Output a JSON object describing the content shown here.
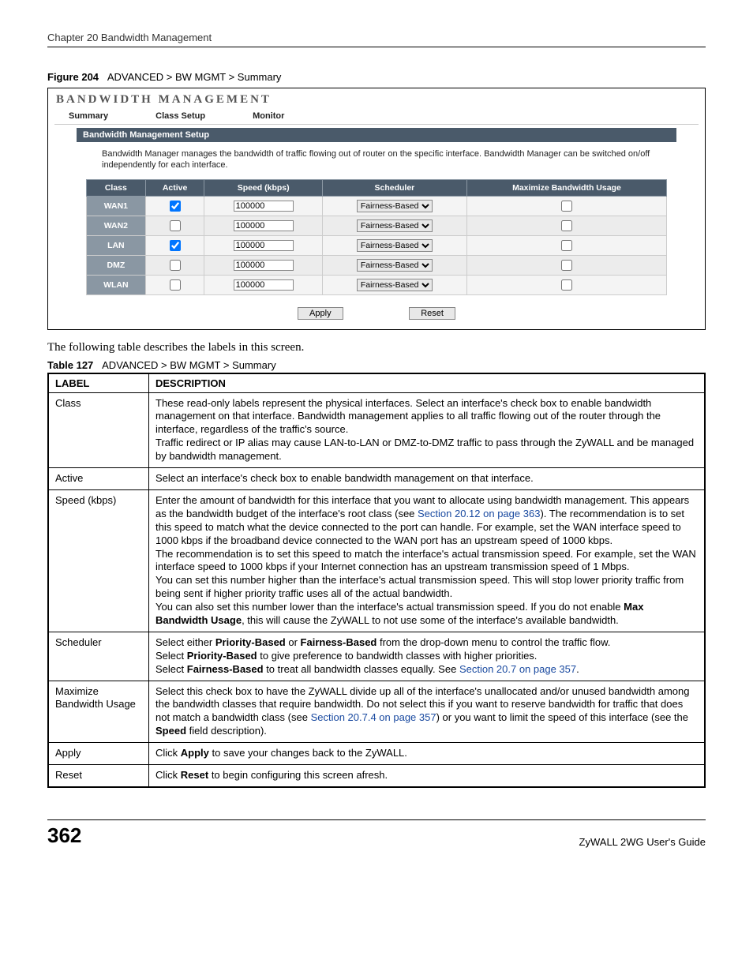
{
  "chapter": "Chapter 20 Bandwidth Management",
  "figure": {
    "label": "Figure 204",
    "caption": "ADVANCED > BW MGMT > Summary"
  },
  "screenshot": {
    "title": "BANDWIDTH MANAGEMENT",
    "tabs": {
      "summary": "Summary",
      "class_setup": "Class Setup",
      "monitor": "Monitor"
    },
    "section_bar": "Bandwidth Management Setup",
    "description": "Bandwidth Manager manages the bandwidth of traffic flowing out of router on the specific interface. Bandwidth Manager can be switched on/off independently for each interface.",
    "headers": {
      "class": "Class",
      "active": "Active",
      "speed": "Speed (kbps)",
      "scheduler": "Scheduler",
      "max": "Maximize Bandwidth Usage"
    },
    "rows": [
      {
        "class": "WAN1",
        "active": true,
        "speed": "100000",
        "scheduler": "Fairness-Based",
        "max": false
      },
      {
        "class": "WAN2",
        "active": false,
        "speed": "100000",
        "scheduler": "Fairness-Based",
        "max": false
      },
      {
        "class": "LAN",
        "active": true,
        "speed": "100000",
        "scheduler": "Fairness-Based",
        "max": false
      },
      {
        "class": "DMZ",
        "active": false,
        "speed": "100000",
        "scheduler": "Fairness-Based",
        "max": false
      },
      {
        "class": "WLAN",
        "active": false,
        "speed": "100000",
        "scheduler": "Fairness-Based",
        "max": false
      }
    ],
    "buttons": {
      "apply": "Apply",
      "reset": "Reset"
    }
  },
  "lead_text": "The following table describes the labels in this screen.",
  "table_caption": {
    "label": "Table 127",
    "caption": "ADVANCED > BW MGMT > Summary"
  },
  "desc_headers": {
    "label": "LABEL",
    "description": "DESCRIPTION"
  },
  "desc_rows": {
    "class": {
      "label": "Class",
      "p1": "These read-only labels represent the physical interfaces. Select an interface's check box to enable bandwidth management on that interface. Bandwidth management applies to all traffic flowing out of the router through the interface, regardless of the traffic's source.",
      "p2": "Traffic redirect or IP alias may cause LAN-to-LAN or DMZ-to-DMZ traffic to pass through the ZyWALL and be managed by bandwidth management."
    },
    "active": {
      "label": "Active",
      "p1": "Select an interface's check box to enable bandwidth management on that interface."
    },
    "speed": {
      "label": "Speed (kbps)",
      "p1a": "Enter the amount of bandwidth for this interface that you want to allocate using bandwidth management. This appears as the bandwidth budget of the interface's root class (see ",
      "link1": "Section 20.12 on page 363",
      "p1b": "). The recommendation is to set this speed to match what the device connected to the port can handle. For example, set the WAN interface speed to 1000 kbps if the broadband device connected to the WAN port has an upstream speed of 1000 kbps.",
      "p2": "The recommendation is to set this speed to match the interface's actual transmission speed. For example, set the WAN interface speed to 1000 kbps if your Internet connection has an upstream transmission speed of 1 Mbps.",
      "p3": "You can set this number higher than the interface's actual transmission speed. This will stop lower priority traffic from being sent if higher priority traffic uses all of the actual bandwidth.",
      "p4a": "You can also set this number lower than the interface's actual transmission speed. If you do not enable ",
      "p4b_bold": "Max Bandwidth Usage",
      "p4c": ", this will cause the ZyWALL to not use some of the interface's available bandwidth."
    },
    "scheduler": {
      "label": "Scheduler",
      "p1a": "Select either ",
      "p1b_bold": "Priority-Based",
      "p1c": " or ",
      "p1d_bold": "Fairness-Based",
      "p1e": " from the drop-down menu to control the traffic flow.",
      "p2a": "Select ",
      "p2b_bold": "Priority-Based",
      "p2c": " to give preference to bandwidth classes with higher priorities.",
      "p3a": "Select ",
      "p3b_bold": "Fairness-Based",
      "p3c": " to treat all bandwidth classes equally. See ",
      "link1": "Section 20.7 on page 357",
      "p3d": "."
    },
    "max": {
      "label": "Maximize Bandwidth Usage",
      "p1a": "Select this check box to have the ZyWALL divide up all of the interface's unallocated and/or unused bandwidth among the bandwidth classes that require bandwidth. Do not select this if you want to reserve bandwidth for traffic that does not match a bandwidth class (see ",
      "link1": "Section 20.7.4 on page 357",
      "p1b": ") or you want to limit the speed of this interface (see the ",
      "p1c_bold": "Speed",
      "p1d": " field description)."
    },
    "apply": {
      "label": "Apply",
      "p1a": "Click ",
      "p1b_bold": "Apply",
      "p1c": " to save your changes back to the ZyWALL."
    },
    "reset": {
      "label": "Reset",
      "p1a": "Click ",
      "p1b_bold": "Reset",
      "p1c": " to begin configuring this screen afresh."
    }
  },
  "footer": {
    "page": "362",
    "guide": "ZyWALL 2WG User's Guide"
  }
}
